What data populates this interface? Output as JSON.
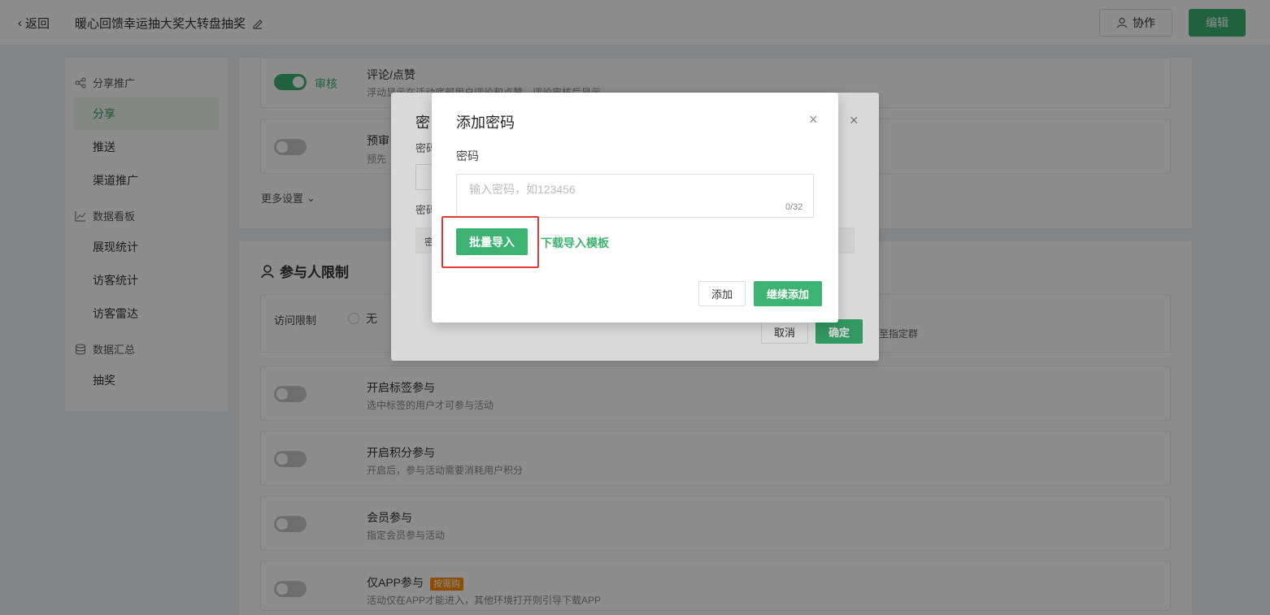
{
  "topbar": {
    "back_label": "返回",
    "title": "暖心回馈幸运抽大奖大转盘抽奖",
    "collab_label": "协作",
    "edit_label": "编辑"
  },
  "sidebar": {
    "groups": [
      {
        "label": "分享推广",
        "items": [
          "分享",
          "推送",
          "渠道推广"
        ]
      },
      {
        "label": "数据看板",
        "items": [
          "展现统计",
          "访客统计",
          "访客雷达"
        ]
      },
      {
        "label": "数据汇总",
        "items": [
          "抽奖"
        ]
      }
    ]
  },
  "section1": {
    "comment_toggle_label": "审核",
    "comment_title": "评论/点赞",
    "comment_desc": "浮动显示在活动底部用户评论和点赞，评论审核后显示",
    "preview_title": "预审",
    "preview_desc": "预先",
    "more_settings": "更多设置"
  },
  "section2": {
    "title": "参与人限制",
    "access_label": "访问限制",
    "access_option_none": "无",
    "access_hint": "至指定群",
    "tag_title": "开启标签参与",
    "tag_desc": "选中标签的用户才可参与活动",
    "points_title": "开启积分参与",
    "points_desc": "开启后，参与活动需要消耗用户积分",
    "member_title": "会员参与",
    "member_desc": "指定会员参与活动",
    "app_title": "仅APP参与",
    "app_tag": "按需购",
    "app_desc": "活动仅在APP才能进入，其他环境打开则引导下载APP"
  },
  "dialog_back": {
    "title_partial": "密",
    "row1_label": "密码",
    "row2_label": "密码",
    "row3_label": "密",
    "cancel_label": "取消",
    "confirm_label": "确定"
  },
  "dialog_front": {
    "title": "添加密码",
    "field_label": "密码",
    "placeholder": "输入密码，如123456",
    "counter": "0/32",
    "batch_import_label": "批量导入",
    "download_template_label": "下载导入模板",
    "add_label": "添加",
    "continue_add_label": "继续添加"
  },
  "colors": {
    "accent": "#3cb371",
    "highlight": "#e53935",
    "tag": "#ff8a00"
  }
}
